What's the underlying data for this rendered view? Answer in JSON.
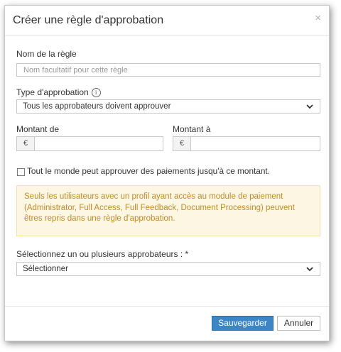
{
  "modal": {
    "title": "Créer une règle d'approbation",
    "close_glyph": "×"
  },
  "rule_name": {
    "label": "Nom de la règle",
    "placeholder": "Nom facultatif pour cette règle"
  },
  "approval_type": {
    "label": "Type d'approbation",
    "info_icon": "info-icon",
    "selected": "Tous les approbateurs doivent approuver"
  },
  "amount_from": {
    "label": "Montant de",
    "currency": "€"
  },
  "amount_to": {
    "label": "Montant à",
    "currency": "€"
  },
  "everyone_checkbox": {
    "label": "Tout le monde peut approuver des paiements jusqu'à ce montant.",
    "checked": false
  },
  "alert": {
    "text": "Seuls les utilisateurs avec un profil ayant accès au module de paiement (Administrator, Full Access, Full Feedback, Document Processing) peuvent êtres repris dans une règle d'approbation."
  },
  "approvers": {
    "label": "Sélectionnez un ou plusieurs approbateurs : *",
    "placeholder": "Sélectionner"
  },
  "footer": {
    "save_label": "Sauvegarder",
    "cancel_label": "Annuler"
  },
  "colors": {
    "primary": "#3d86c6",
    "alert_bg": "#fcf6e3",
    "alert_text": "#c08d2a"
  }
}
